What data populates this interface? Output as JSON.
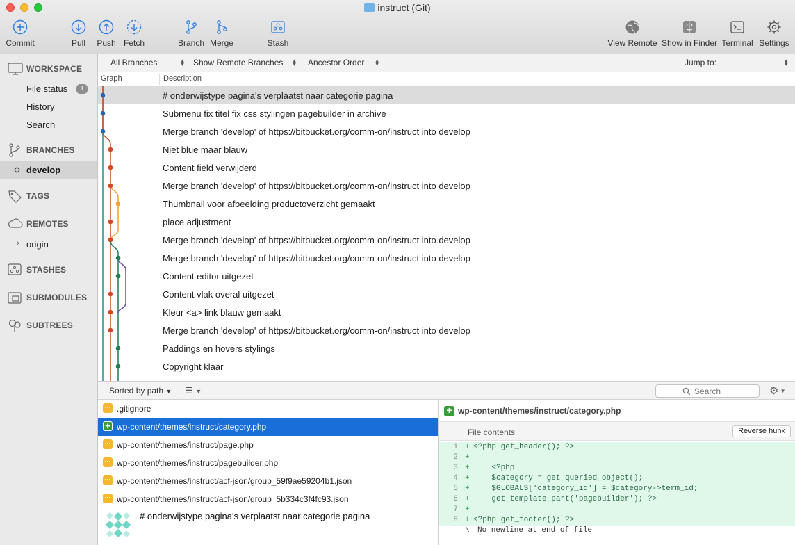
{
  "window": {
    "title": "instruct (Git)"
  },
  "toolbar": {
    "commit": "Commit",
    "pull": "Pull",
    "push": "Push",
    "fetch": "Fetch",
    "branch": "Branch",
    "merge": "Merge",
    "stash": "Stash",
    "view_remote": "View Remote",
    "show_in_finder": "Show in Finder",
    "terminal": "Terminal",
    "settings": "Settings"
  },
  "sidebar": {
    "workspace": "WORKSPACE",
    "file_status": "File status",
    "file_status_count": "1",
    "history": "History",
    "search": "Search",
    "branches": "BRANCHES",
    "current_branch": "develop",
    "tags": "TAGS",
    "remotes": "REMOTES",
    "origin": "origin",
    "stashes": "STASHES",
    "submodules": "SUBMODULES",
    "subtrees": "SUBTREES"
  },
  "filters": {
    "branches": "All Branches",
    "remote": "Show Remote Branches",
    "order": "Ancestor Order",
    "jump_to": "Jump to:"
  },
  "columns": {
    "graph": "Graph",
    "description": "Description"
  },
  "commits": [
    "# onderwijstype pagina's verplaatst naar categorie pagina",
    "Submenu fix titel fix css stylingen pagebuilder in archive",
    "Merge branch 'develop' of https://bitbucket.org/comm-on/instruct into develop",
    "Niet blue maar blauw",
    "Content field verwijderd",
    "Merge branch 'develop' of https://bitbucket.org/comm-on/instruct into develop",
    "Thumbnail voor afbeelding productoverzicht gemaakt",
    "place adjustment",
    "Merge branch 'develop' of https://bitbucket.org/comm-on/instruct into develop",
    "Merge branch 'develop' of https://bitbucket.org/comm-on/instruct into develop",
    "Content editor uitgezet",
    "Content vlak overal uitgezet",
    "Kleur <a> link blauw gemaakt",
    "Merge branch 'develop' of https://bitbucket.org/comm-on/instruct into develop",
    "Paddings en hovers stylings",
    "Copyright klaar"
  ],
  "bottom_bar": {
    "sort": "Sorted by path",
    "search_placeholder": "Search"
  },
  "files": [
    ".gitignore",
    "wp-content/themes/instruct/category.php",
    "wp-content/themes/instruct/page.php",
    "wp-content/themes/instruct/pagebuilder.php",
    "wp-content/themes/instruct/acf-json/group_59f9ae59204b1.json",
    "wp-content/themes/instruct/acf-json/group_5b334c3f4fc93.json"
  ],
  "commit_message": "# onderwijstype pagina's verplaatst naar categorie pagina",
  "diff": {
    "file": "wp-content/themes/instruct/category.php",
    "hunk_title": "File contents",
    "reverse_hunk": "Reverse hunk",
    "lines": [
      {
        "n": "1",
        "code": "<?php get_header(); ?>"
      },
      {
        "n": "2",
        "code": ""
      },
      {
        "n": "3",
        "code": "    <?php"
      },
      {
        "n": "4",
        "code": "    $category = get_queried_object();"
      },
      {
        "n": "5",
        "code": "    $GLOBALS['category_id'] = $category->term_id;"
      },
      {
        "n": "6",
        "code": "    get_template_part('pagebuilder'); ?>"
      },
      {
        "n": "7",
        "code": ""
      },
      {
        "n": "8",
        "code": "<?php get_footer(); ?>"
      }
    ],
    "no_newline": "No newline at end of file"
  },
  "colors": {
    "graph_blue": "#1f67b8",
    "graph_red": "#d04a1f",
    "graph_orange": "#f2a12b",
    "graph_green": "#1d7d54",
    "graph_purple": "#6a4aa8",
    "graph_teal": "#2a8a8f",
    "selection": "#1a6ed8",
    "added_bg": "#dff8ea"
  }
}
